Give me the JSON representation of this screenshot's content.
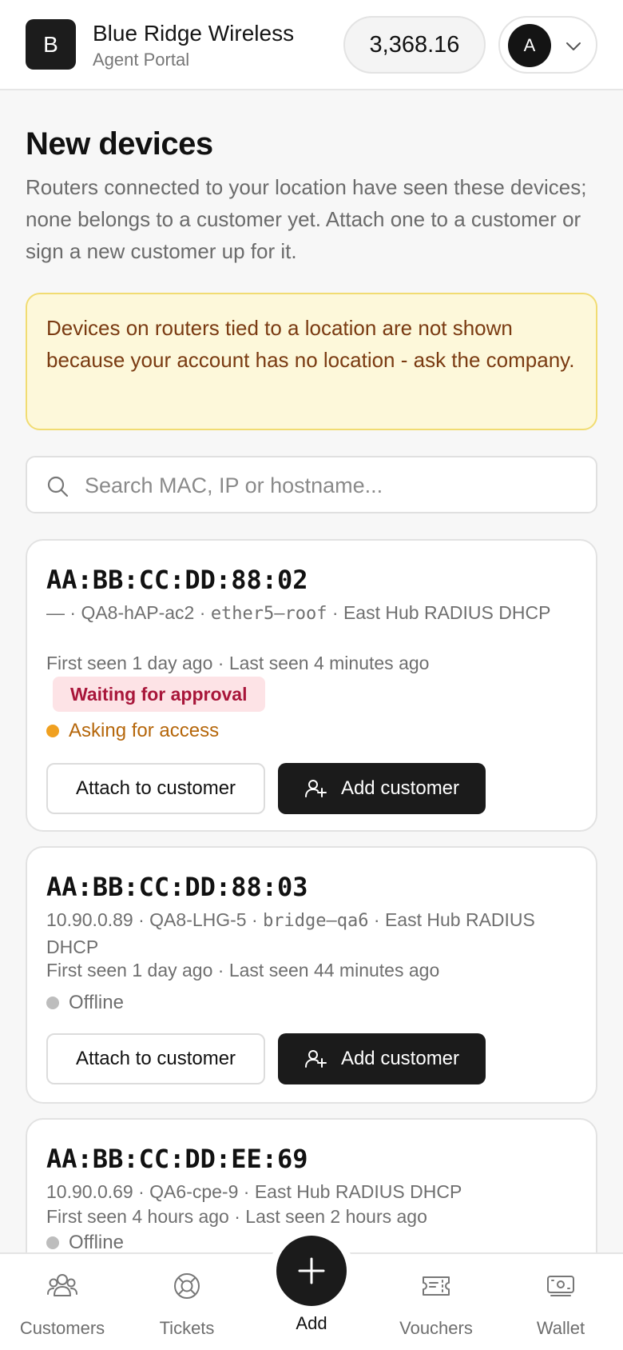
{
  "header": {
    "logo_letter": "B",
    "brand_name": "Blue Ridge Wireless",
    "brand_sub": "Agent Portal",
    "balance": "3,368.16",
    "avatar_letter": "A"
  },
  "page": {
    "title": "New devices",
    "description": "Routers connected to your location have seen these devices; none belongs to a customer yet. Attach one to a customer or sign a new customer up for it."
  },
  "notice": {
    "text": "Devices on routers tied to a location are not shown because your account has no location - ask the company."
  },
  "search": {
    "placeholder": "Search MAC, IP or hostname...",
    "value": ""
  },
  "devices": [
    {
      "mac": "AA:BB:CC:DD:88:02",
      "ip": "—",
      "router": "QA8-hAP-ac2",
      "interface": "ether5—roof",
      "dhcp": "East Hub RADIUS DHCP",
      "seen": "First seen 1 day ago · Last seen 4 minutes ago",
      "badge": "Waiting for approval",
      "status": "Asking for access",
      "status_color": "#f0a020",
      "status_text_color": "#b5660a"
    },
    {
      "mac": "AA:BB:CC:DD:88:03",
      "ip": "10.90.0.89",
      "router": "QA8-LHG-5",
      "interface": "bridge—qa6",
      "dhcp": "East Hub RADIUS DHCP",
      "seen": "First seen 1 day ago · Last seen 44 minutes ago",
      "status": "Offline",
      "status_color": "#bdbdbd",
      "status_text_color": "#6f6f6f"
    },
    {
      "mac": "AA:BB:CC:DD:EE:69",
      "ip": "10.90.0.69",
      "router": "QA6-cpe-9",
      "dhcp": "East Hub RADIUS DHCP",
      "seen": "First seen 4 hours ago · Last seen 2 hours ago",
      "status": "Offline",
      "status_color": "#bdbdbd",
      "status_text_color": "#6f6f6f"
    }
  ],
  "actions": {
    "attach_label": "Attach to customer",
    "add_label": "Add customer"
  },
  "separator": " · ",
  "bottom_nav": {
    "customers": "Customers",
    "tickets": "Tickets",
    "add": "Add",
    "vouchers": "Vouchers",
    "wallet": "Wallet"
  },
  "icons": {
    "search": "search-icon",
    "chevron": "chevron-down-icon",
    "add_person": "user-plus-icon",
    "customers": "users-icon",
    "tickets": "lifebuoy-icon",
    "add": "plus-icon",
    "vouchers": "ticket-icon",
    "wallet": "banknote-icon"
  }
}
